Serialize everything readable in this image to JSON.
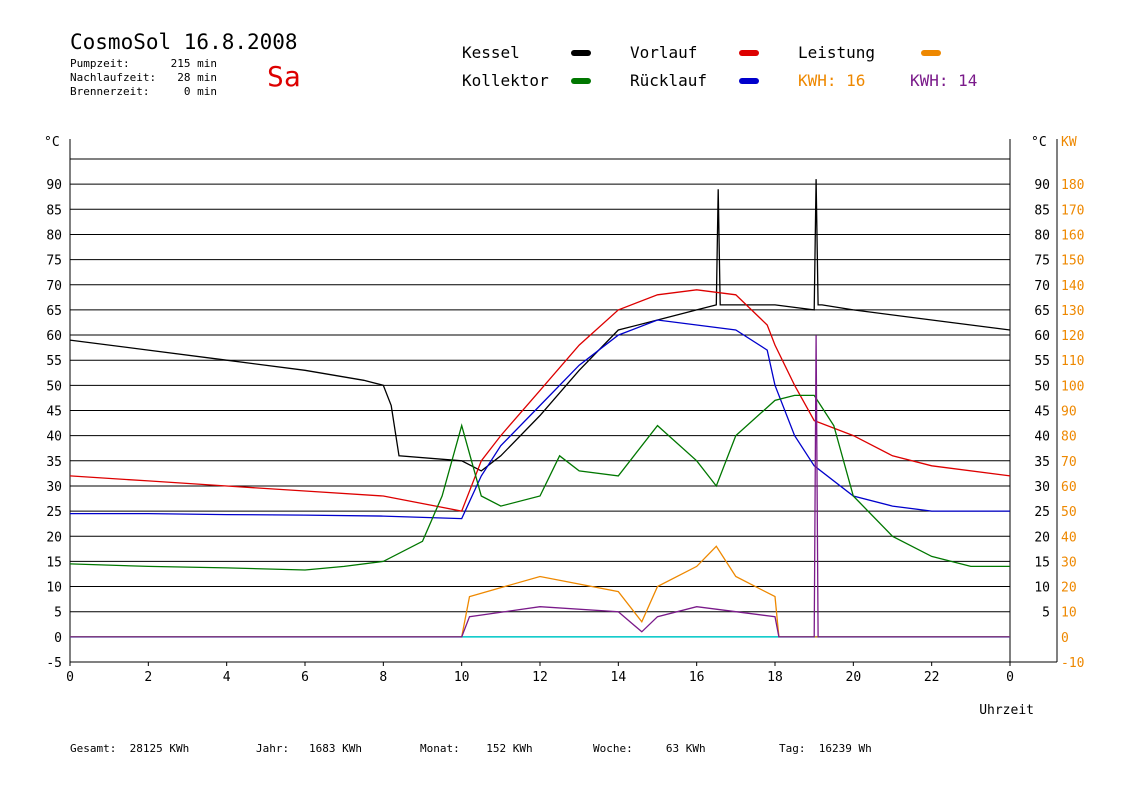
{
  "header": {
    "title": "CosmoSol 16.8.2008",
    "day": "Sa",
    "stats": [
      {
        "label": "Pumpzeit:",
        "value": "215 min"
      },
      {
        "label": "Nachlaufzeit:",
        "value": "28 min"
      },
      {
        "label": "Brennerzeit:",
        "value": "0 min"
      }
    ]
  },
  "legend": {
    "kessel": "Kessel",
    "vorlauf": "Vorlauf",
    "leistung": "Leistung",
    "kollektor": "Kollektor",
    "ruecklauf": "Rücklauf",
    "kwh1_label": "KWH:",
    "kwh1_value": "16",
    "kwh2_label": "KWH:",
    "kwh2_value": "14"
  },
  "footer": [
    {
      "label": "Gesamt:",
      "value": "28125 KWh"
    },
    {
      "label": "Jahr:",
      "value": "1683 KWh"
    },
    {
      "label": "Monat:",
      "value": "152 KWh"
    },
    {
      "label": "Woche:",
      "value": "63 KWh"
    },
    {
      "label": "Tag:",
      "value": "16239 Wh"
    }
  ],
  "colors": {
    "kessel": "#000000",
    "vorlauf": "#dd0000",
    "ruecklauf": "#0000cc",
    "kollektor": "#007700",
    "leistung": "#ee8800",
    "kwh2": "#7a1a8a",
    "baseline": "#00cccc",
    "day": "#dd0000"
  },
  "chart_data": {
    "type": "line",
    "xlabel": "Uhrzeit",
    "ylabel_left": "°C",
    "ylabel_right": "KW",
    "x_range": [
      0,
      24
    ],
    "y_left_range": [
      -5,
      95
    ],
    "y_right_range": [
      -10,
      190
    ],
    "x_ticks": [
      "0",
      "2",
      "4",
      "6",
      "8",
      "10",
      "12",
      "14",
      "16",
      "18",
      "20",
      "22",
      "0"
    ],
    "y_left_ticks": [
      "-5",
      "0",
      "5",
      "10",
      "15",
      "20",
      "25",
      "30",
      "35",
      "40",
      "45",
      "50",
      "55",
      "60",
      "65",
      "70",
      "75",
      "80",
      "85",
      "90"
    ],
    "y_right_ticks_left": [
      "5",
      "10",
      "15",
      "20",
      "25",
      "30",
      "35",
      "40",
      "45",
      "50",
      "55",
      "60",
      "65",
      "70",
      "75",
      "80",
      "85",
      "90"
    ],
    "y_right_ticks_right": [
      "-10",
      "0",
      "10",
      "20",
      "30",
      "40",
      "50",
      "60",
      "70",
      "80",
      "90",
      "100",
      "110",
      "120",
      "130",
      "140",
      "150",
      "160",
      "170",
      "180"
    ],
    "grid": true,
    "series": [
      {
        "name": "Kessel",
        "x": [
          0,
          2,
          4,
          6,
          7.5,
          8,
          8.2,
          8.4,
          10,
          10.5,
          11,
          12,
          13,
          14,
          15,
          16,
          16.5,
          16.55,
          16.6,
          17,
          18,
          19,
          19.05,
          19.1,
          19.2,
          20,
          22,
          24
        ],
        "y": [
          59,
          57,
          55,
          53,
          51,
          50,
          46,
          36,
          35,
          33,
          36,
          44,
          53,
          61,
          63,
          65,
          66,
          89,
          66,
          66,
          66,
          65,
          91,
          66,
          66,
          65,
          63,
          61
        ]
      },
      {
        "name": "Vorlauf",
        "x": [
          0,
          2,
          4,
          6,
          8,
          10,
          10.5,
          11,
          12,
          13,
          14,
          15,
          16,
          17,
          17.8,
          18,
          18.5,
          19,
          20,
          21,
          22,
          24
        ],
        "y": [
          32,
          31,
          30,
          29,
          28,
          25,
          35,
          40,
          49,
          58,
          65,
          68,
          69,
          68,
          62,
          58,
          50,
          43,
          40,
          36,
          34,
          32
        ]
      },
      {
        "name": "Rücklauf",
        "x": [
          0,
          2,
          4,
          6,
          8,
          10,
          10.5,
          11,
          12,
          13,
          14,
          15,
          16,
          17,
          17.8,
          18,
          18.5,
          19,
          20,
          21,
          22,
          24
        ],
        "y": [
          24.5,
          24.5,
          24.3,
          24.2,
          24,
          23.5,
          32,
          38,
          46,
          54,
          60,
          63,
          62,
          61,
          57,
          50,
          40,
          34,
          28,
          26,
          25,
          25
        ]
      },
      {
        "name": "Kollektor",
        "x": [
          0,
          2,
          4,
          6,
          7,
          8,
          9,
          9.5,
          10,
          10.5,
          11,
          12,
          12.5,
          13,
          14,
          15,
          16,
          16.5,
          17,
          18,
          18.5,
          19,
          19.5,
          20,
          21,
          22,
          23,
          24
        ],
        "y": [
          14.5,
          14,
          13.7,
          13.3,
          14,
          15,
          19,
          28,
          42,
          28,
          26,
          28,
          36,
          33,
          32,
          42,
          35,
          30,
          40,
          47,
          48,
          48,
          42,
          28,
          20,
          16,
          14,
          14
        ]
      },
      {
        "name": "Leistung",
        "x": [
          0,
          10,
          10.2,
          12,
          14,
          14.6,
          15,
          16,
          16.5,
          17,
          18,
          18.1,
          24
        ],
        "y": [
          0,
          0,
          8,
          12,
          9,
          3,
          10,
          14,
          18,
          12,
          8,
          0,
          0
        ]
      },
      {
        "name": "KWH",
        "x": [
          0,
          10,
          10.2,
          12,
          14,
          14.6,
          15,
          16,
          17,
          18,
          18.1,
          19,
          19.05,
          19.1,
          19.2,
          24
        ],
        "y": [
          0,
          0,
          4,
          6,
          5,
          1,
          4,
          6,
          5,
          4,
          0,
          0,
          60,
          0,
          0,
          0
        ]
      }
    ]
  }
}
